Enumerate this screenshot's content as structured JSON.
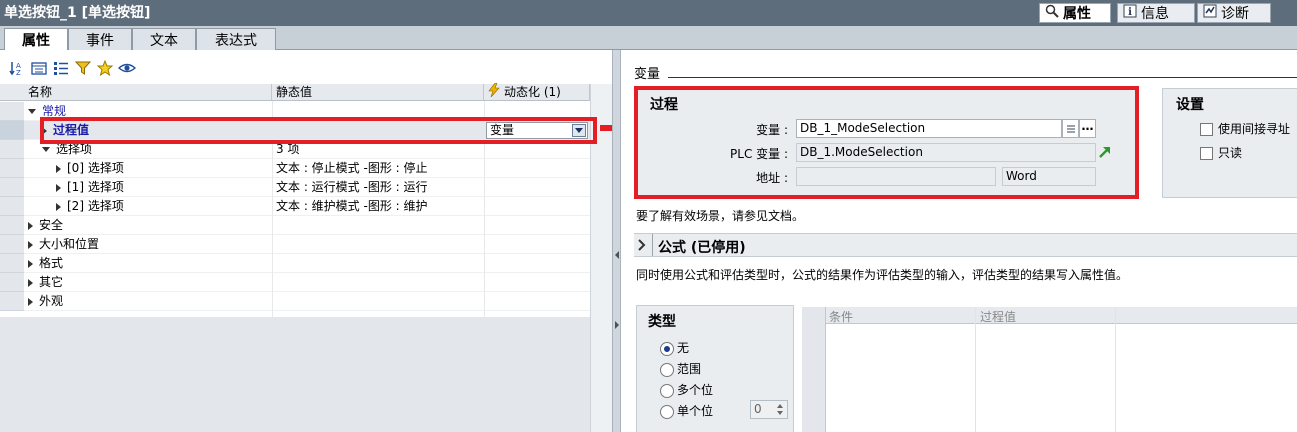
{
  "window": {
    "title": "单选按钮_1 [单选按钮]"
  },
  "top_tabs": [
    {
      "label": "属性",
      "icon": "properties-magnifier-icon",
      "active": true
    },
    {
      "label": "信息",
      "icon": "info-icon",
      "active": false
    },
    {
      "label": "诊断",
      "icon": "diagnostics-icon",
      "active": false
    }
  ],
  "inner_tabs": [
    "属性",
    "事件",
    "文本",
    "表达式"
  ],
  "toolbar_icons": [
    "sort-az-icon",
    "group-icon",
    "list-view-icon",
    "filter-icon",
    "favorites-star-icon",
    "visibility-eye-icon"
  ],
  "grid": {
    "headers": {
      "name": "名称",
      "static": "静态值",
      "dynamic": "动态化 (1)"
    },
    "rows": [
      {
        "name": "常规",
        "static": "",
        "indent": 1,
        "expander": "down",
        "style": "category"
      },
      {
        "name": "过程值",
        "static": "",
        "dynamic": "变量",
        "indent": 2,
        "expander": "right",
        "style": "selected"
      },
      {
        "name": "选择项",
        "static": "3 项",
        "indent": 2,
        "expander": "down"
      },
      {
        "name": "[0] 选择项",
        "static": "文本 : 停止模式 -图形 : 停止",
        "indent": 3,
        "expander": "right"
      },
      {
        "name": "[1] 选择项",
        "static": "文本 : 运行模式 -图形 : 运行",
        "indent": 3,
        "expander": "right"
      },
      {
        "name": "[2] 选择项",
        "static": "文本 : 维护模式 -图形 : 维护",
        "indent": 3,
        "expander": "right"
      },
      {
        "name": "安全",
        "static": "",
        "indent": 1,
        "expander": "right"
      },
      {
        "name": "大小和位置",
        "static": "",
        "indent": 1,
        "expander": "right"
      },
      {
        "name": "格式",
        "static": "",
        "indent": 1,
        "expander": "right"
      },
      {
        "name": "其它",
        "static": "",
        "indent": 1,
        "expander": "right"
      },
      {
        "name": "外观",
        "static": "",
        "indent": 1,
        "expander": "right"
      }
    ]
  },
  "right": {
    "section_title": "变量",
    "process": {
      "title": "过程",
      "variable_label": "变量 :",
      "variable_value": "DB_1_ModeSelection",
      "plc_label": "PLC 变量 :",
      "plc_value": "DB_1.ModeSelection",
      "address_label": "地址 :",
      "address_value": "",
      "address_type": "Word"
    },
    "settings": {
      "title": "设置",
      "indirect_label": "使用间接寻址",
      "readonly_label": "只读"
    },
    "help_text": "要了解有效场景，请参见文档。",
    "formula_title": "公式 (已停用)",
    "formula_desc": "同时使用公式和评估类型时，公式的结果作为评估类型的输入，评估类型的结果写入属性值。",
    "type_box": {
      "title": "类型",
      "options": [
        {
          "label": "无",
          "selected": true
        },
        {
          "label": "范围",
          "selected": false
        },
        {
          "label": "多个位",
          "selected": false
        },
        {
          "label": "单个位",
          "selected": false
        }
      ],
      "spinner_value": "0"
    },
    "condition_table": {
      "headers": [
        "条件",
        "过程值"
      ]
    }
  },
  "colors": {
    "highlight_red": "#e31e24",
    "category_blue": "#1a1aa8",
    "title_bar": "#5e6d7b"
  }
}
